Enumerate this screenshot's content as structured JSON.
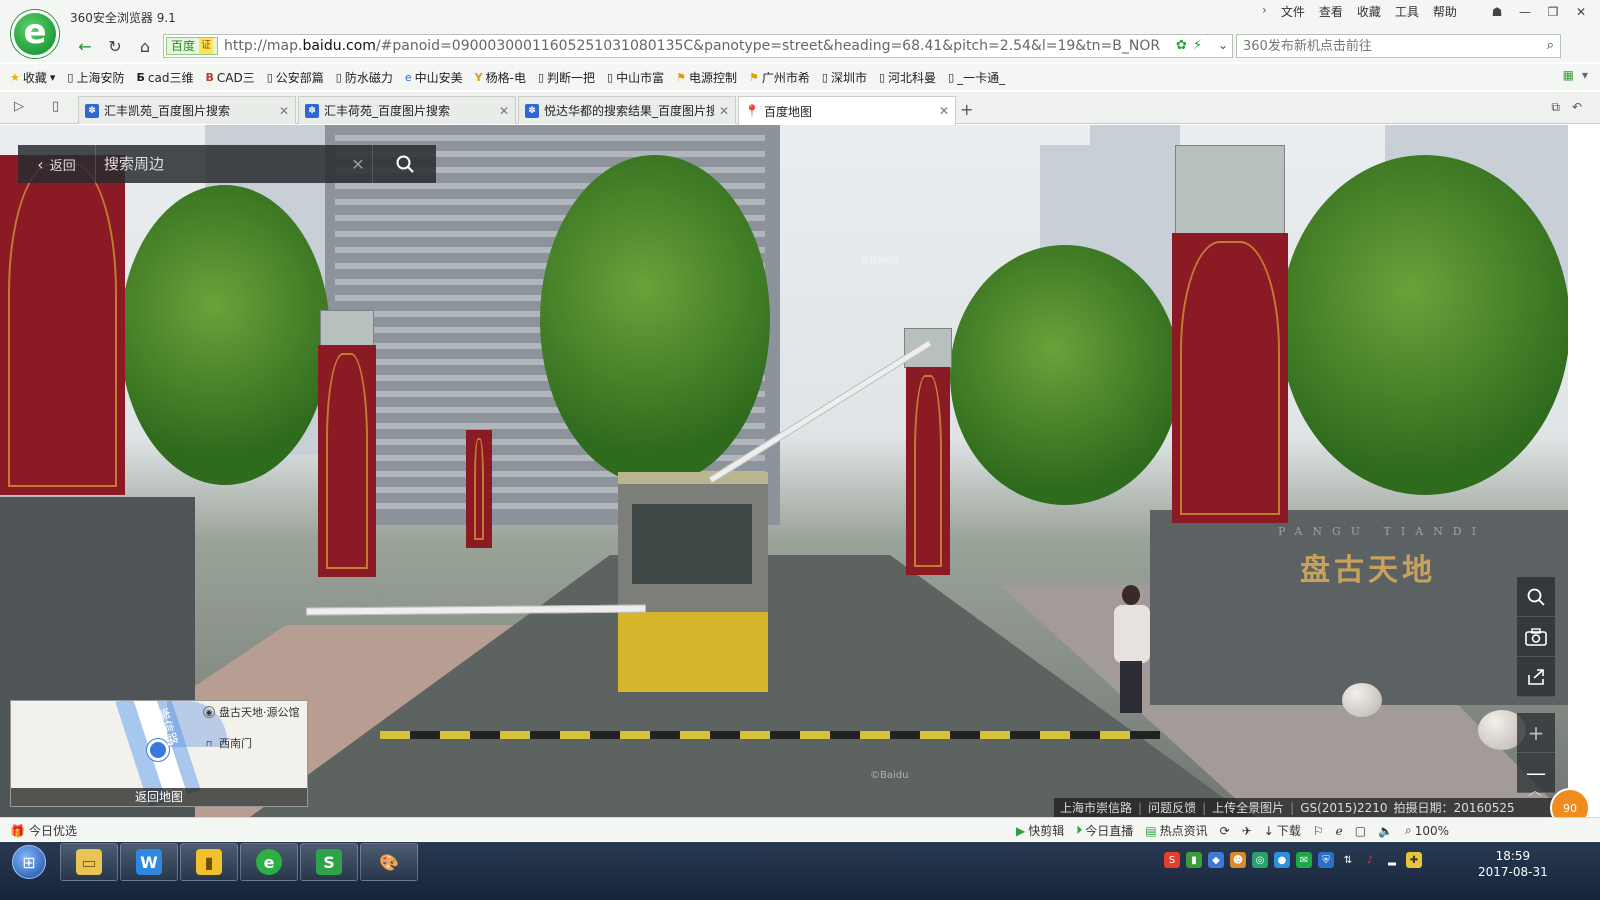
{
  "browser": {
    "title": "360安全浏览器 9.1",
    "menu": [
      "文件",
      "查看",
      "收藏",
      "工具",
      "帮助"
    ],
    "address": {
      "badge_main": "百度",
      "badge_verify": "证",
      "url_prefix": "http://map.",
      "url_host": "baidu.com",
      "url_rest": "/#panoid=09000300011605251031080135C&panotype=street&heading=68.41&pitch=2.54&l=19&tn=B_NOR"
    },
    "search_placeholder": "360发布新机点击前往",
    "bookmarks": [
      {
        "label": "收藏",
        "icon": "star-icon"
      },
      {
        "label": "上海安防",
        "icon": "page-icon"
      },
      {
        "label": "cad三维",
        "icon": "b-icon"
      },
      {
        "label": "CAD三",
        "icon": "b-icon"
      },
      {
        "label": "公安部篇",
        "icon": "page-icon"
      },
      {
        "label": "防水磁力",
        "icon": "page-icon"
      },
      {
        "label": "中山安美",
        "icon": "ie-icon"
      },
      {
        "label": "杨格-电",
        "icon": "y-icon"
      },
      {
        "label": "判断一把",
        "icon": "page-icon"
      },
      {
        "label": "中山市富",
        "icon": "page-icon"
      },
      {
        "label": "电源控制",
        "icon": "flag-icon"
      },
      {
        "label": "广州市希",
        "icon": "flag-icon"
      },
      {
        "label": "深圳市",
        "icon": "page-icon"
      },
      {
        "label": "河北科曼",
        "icon": "page-icon"
      },
      {
        "label": "_一卡通_",
        "icon": "page-icon"
      }
    ],
    "tabs": [
      {
        "label": "汇丰凯苑_百度图片搜索",
        "active": false
      },
      {
        "label": "汇丰荷苑_百度图片搜索",
        "active": false
      },
      {
        "label": "悦达华都的搜索结果_百度图片搜",
        "active": false
      },
      {
        "label": "百度地图",
        "active": true
      }
    ]
  },
  "panorama": {
    "back_label": "返回",
    "search_placeholder": "搜索周边",
    "gate_sign": "盘古天地",
    "gate_sign_pinyin": "PANGU TIANDI",
    "watermark": "©Baidu",
    "minimap": {
      "poi1": "盘古天地·源公馆",
      "poi2": "西南门",
      "road": "崇信路",
      "back_to_map": "返回地图"
    },
    "info": {
      "location": "上海市崇信路",
      "feedback": "问题反馈",
      "upload": "上传全景图片",
      "license": "GS(2015)2210",
      "date_label": "拍摄日期：",
      "date": "20160525"
    },
    "badge": "90"
  },
  "statusbar": {
    "today": "今日优选",
    "items": [
      "快剪辑",
      "今日直播",
      "热点资讯",
      "下载"
    ],
    "zoom": "100%"
  },
  "taskbar": {
    "time": "18:59",
    "date": "2017-08-31"
  }
}
